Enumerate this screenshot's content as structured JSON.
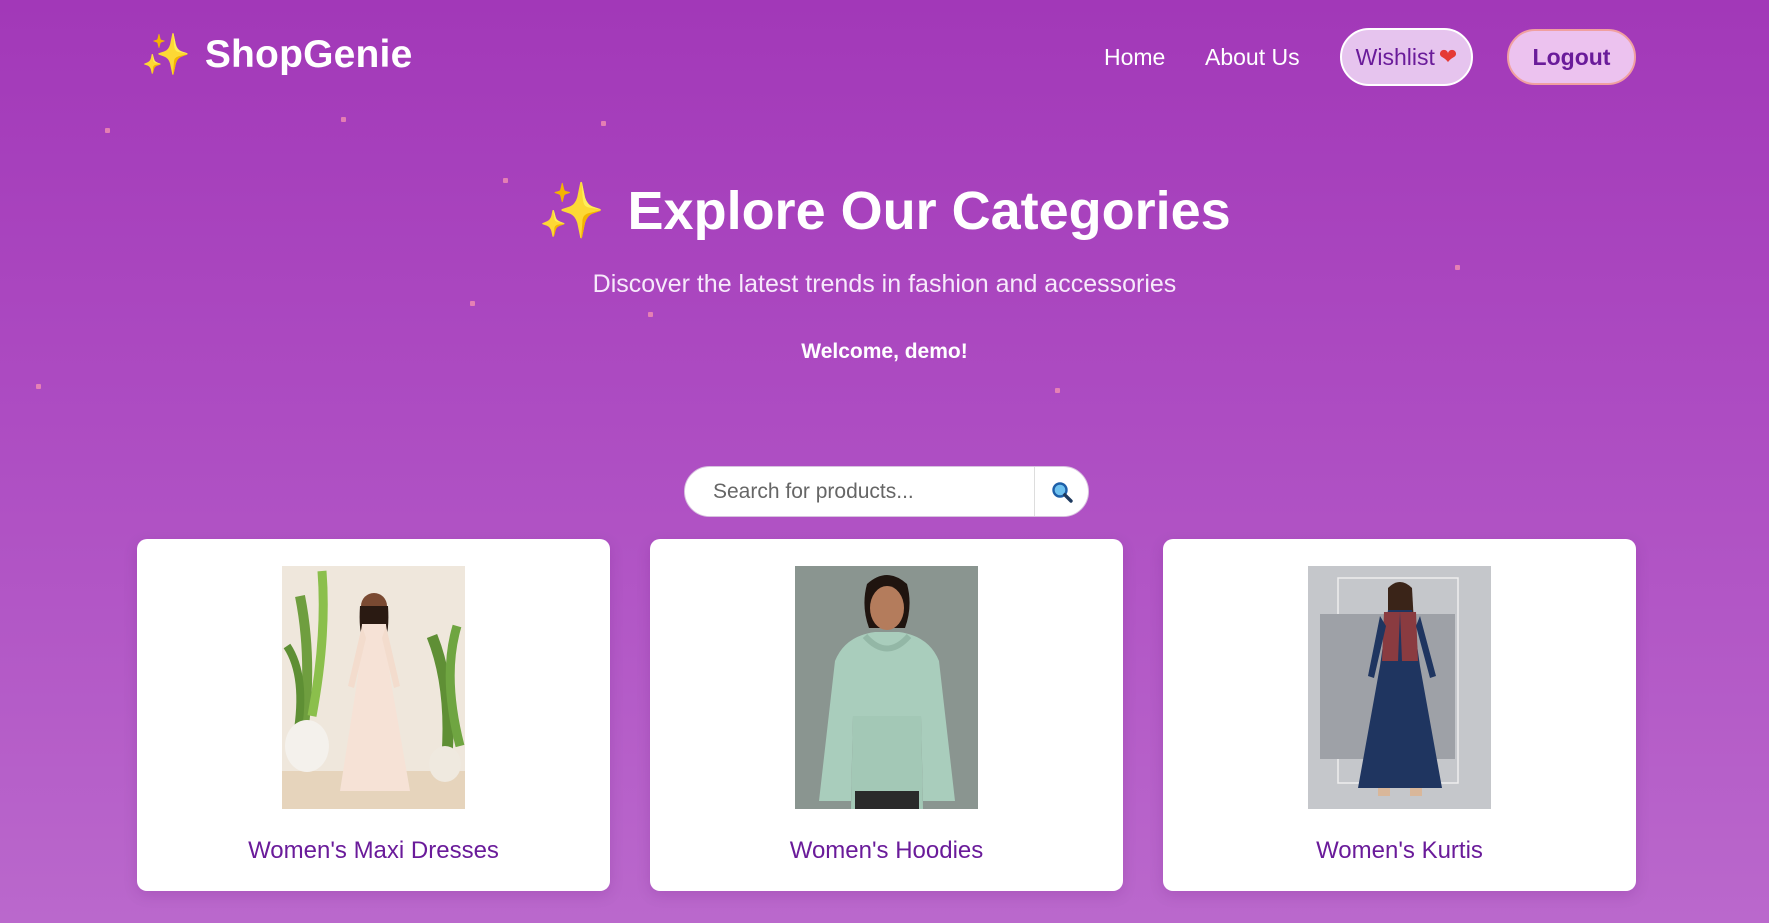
{
  "header": {
    "brand_icon": "sparkles-icon",
    "brand_name": "ShopGenie",
    "nav": {
      "home": "Home",
      "about": "About Us"
    },
    "wishlist_label": "Wishlist",
    "wishlist_icon": "heart-icon",
    "logout_label": "Logout"
  },
  "hero": {
    "title_icon": "sparkles-icon",
    "title": "Explore Our Categories",
    "subtitle": "Discover the latest trends in fashion and accessories",
    "welcome": "Welcome, demo!"
  },
  "search": {
    "placeholder": "Search for products...",
    "button_icon": "magnifier-icon"
  },
  "categories": [
    {
      "title": "Women's Maxi Dresses",
      "image": "maxi-dress-photo"
    },
    {
      "title": "Women's Hoodies",
      "image": "hoodie-photo"
    },
    {
      "title": "Women's Kurtis",
      "image": "kurti-photo"
    }
  ],
  "colors": {
    "background": "#a238b8",
    "accent": "#6a1b9a",
    "sparkle": "#ffd54a"
  }
}
